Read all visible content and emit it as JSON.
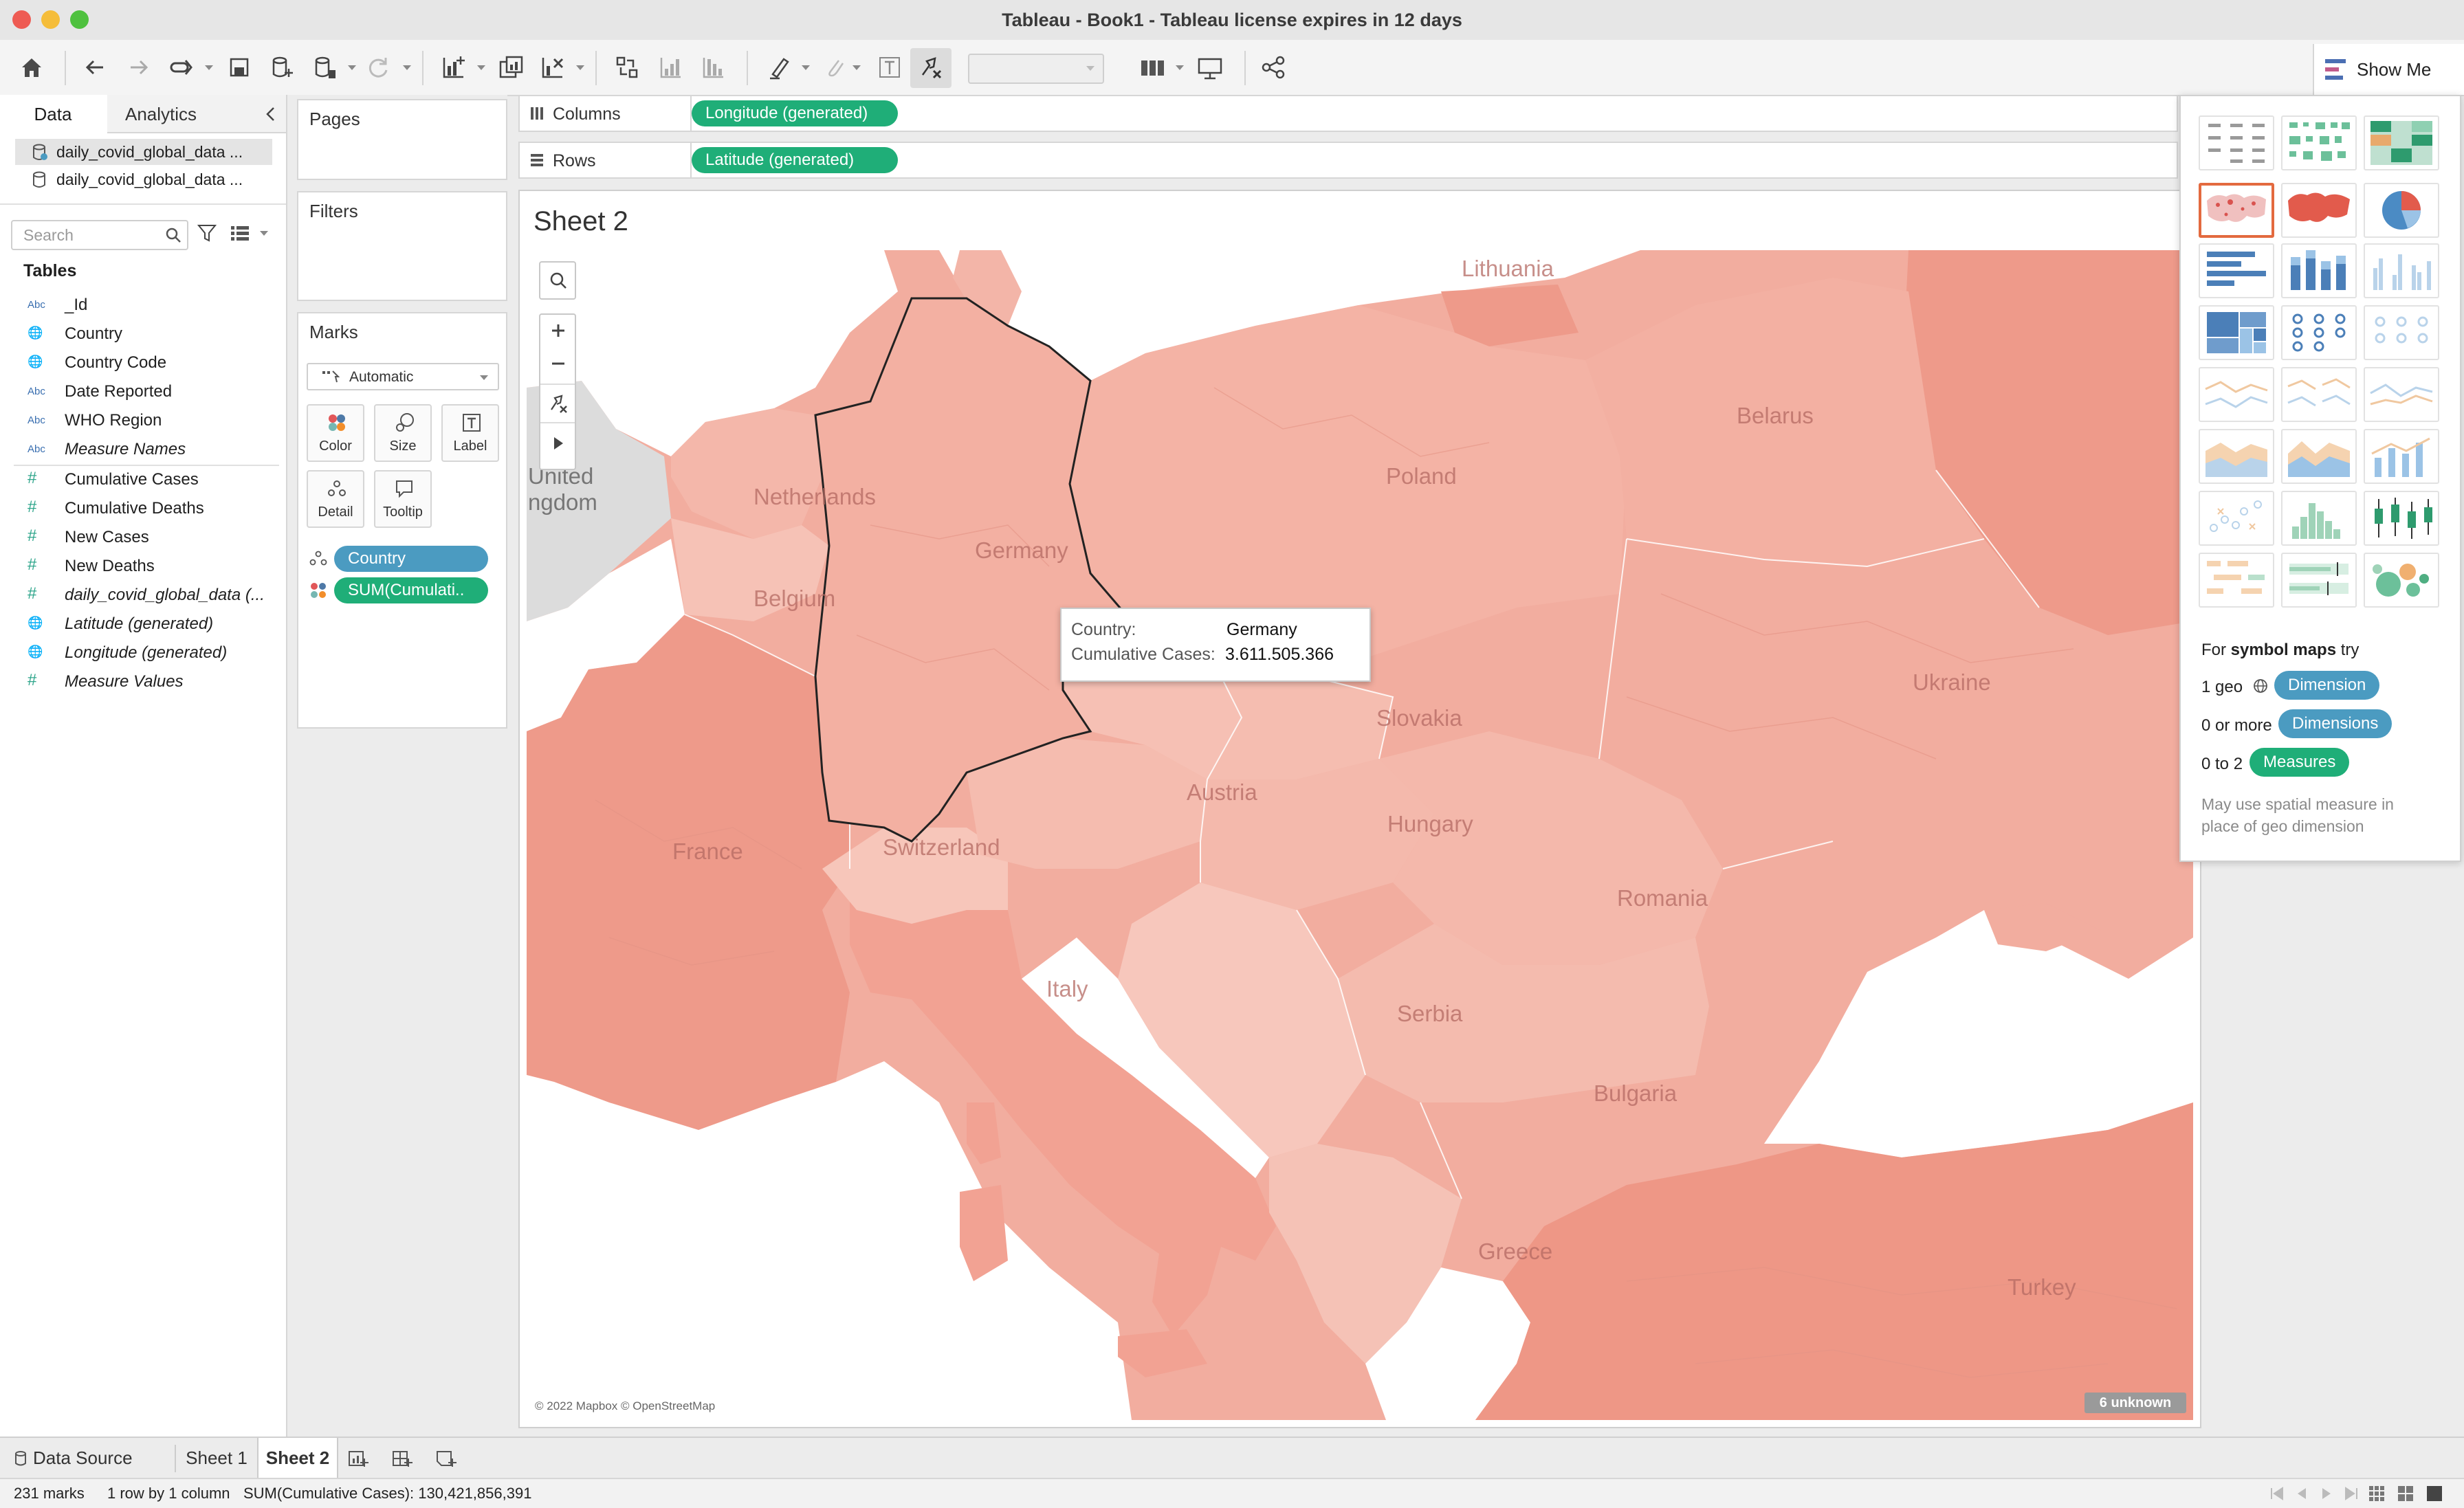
{
  "window": {
    "title": "Tableau - Book1 - Tableau license expires in 12 days"
  },
  "toolbar": {
    "show_me_label": "Show Me"
  },
  "data_pane": {
    "tabs": [
      "Data",
      "Analytics"
    ],
    "data_sources": [
      "daily_covid_global_data ...",
      "daily_covid_global_data ..."
    ],
    "search_placeholder": "Search",
    "tables_heading": "Tables",
    "fields": [
      {
        "type": "Abc",
        "name": "_Id"
      },
      {
        "type": "geo",
        "name": "Country"
      },
      {
        "type": "geo",
        "name": "Country Code"
      },
      {
        "type": "Abc",
        "name": "Date Reported"
      },
      {
        "type": "Abc",
        "name": "WHO Region"
      },
      {
        "type": "Abc",
        "name": "Measure Names"
      },
      {
        "type": "#",
        "name": "Cumulative Cases"
      },
      {
        "type": "#",
        "name": "Cumulative Deaths"
      },
      {
        "type": "#",
        "name": "New Cases"
      },
      {
        "type": "#",
        "name": "New Deaths"
      },
      {
        "type": "#",
        "name": "daily_covid_global_data (..."
      },
      {
        "type": "geo",
        "name": "Latitude (generated)"
      },
      {
        "type": "geo",
        "name": "Longitude (generated)"
      },
      {
        "type": "#",
        "name": "Measure Values"
      }
    ]
  },
  "cards": {
    "pages": "Pages",
    "filters": "Filters",
    "marks": {
      "title": "Marks",
      "type": "Automatic",
      "buttons": [
        "Color",
        "Size",
        "Label",
        "Detail",
        "Tooltip"
      ],
      "pills": [
        "Country",
        "SUM(Cumulati.."
      ]
    }
  },
  "shelves": {
    "columns_label": "Columns",
    "columns_pill": "Longitude (generated)",
    "rows_label": "Rows",
    "rows_pill": "Latitude (generated)"
  },
  "sheet": {
    "title": "Sheet 2",
    "map_labels": [
      "Lithuania",
      "Belarus",
      "Poland",
      "Netherlands",
      "Germany",
      "Belgium",
      "Ukraine",
      "Slovakia",
      "Austria",
      "Hungary",
      "France",
      "Switzerland",
      "Romania",
      "Italy",
      "Serbia",
      "Bulgaria",
      "Greece",
      "Turkey",
      "United",
      "ngdom"
    ],
    "tooltip": {
      "country_key": "Country:",
      "country_value": "Germany",
      "cases_key": "Cumulative Cases:",
      "cases_value": "3.611.505.366"
    },
    "attribution": "© 2022 Mapbox © OpenStreetMap",
    "unknown_badge": "6 unknown"
  },
  "show_me": {
    "hint_prefix": "For",
    "hint_bold": "symbol maps",
    "hint_suffix": "try",
    "req1_label": "1 geo",
    "req1_pill": "Dimension",
    "req2_label": "0 or more",
    "req2_pill": "Dimensions",
    "req3_label": "0 to 2",
    "req3_pill": "Measures",
    "note": "May use spatial measure in place of geo dimension"
  },
  "sheet_tabs": [
    "Data Source",
    "Sheet 1",
    "Sheet 2"
  ],
  "status": {
    "marks": "231 marks",
    "rows_cols": "1 row by 1 column",
    "sum": "SUM(Cumulative Cases): 130,421,856,391"
  },
  "colors": {
    "accent_green": "#1fae78",
    "accent_blue": "#4b9bc1",
    "map_fill": "#f2a89b",
    "selected_thumb": "#e36a3f"
  }
}
